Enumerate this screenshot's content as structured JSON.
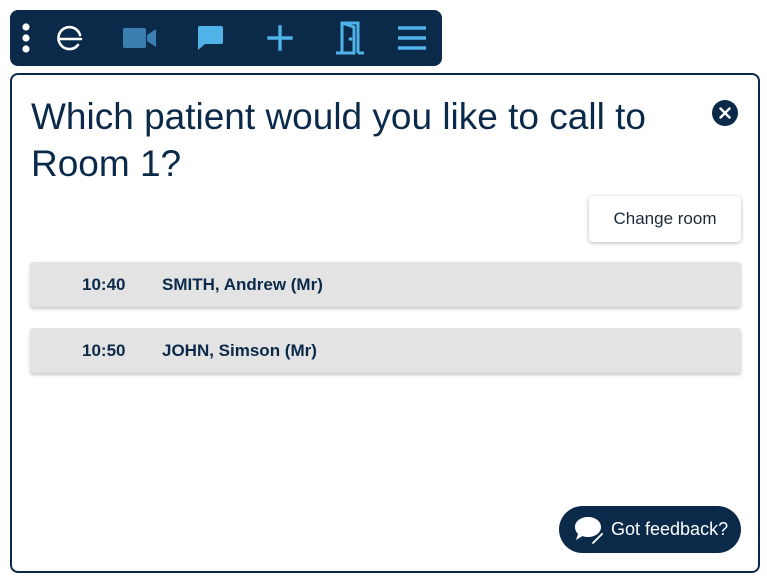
{
  "toolbar": {
    "items": [
      {
        "icon": "more-vertical-icon"
      },
      {
        "icon": "e-logo-icon"
      },
      {
        "icon": "video-camera-icon"
      },
      {
        "icon": "chat-icon"
      },
      {
        "icon": "plus-icon"
      },
      {
        "icon": "door-icon"
      },
      {
        "icon": "menu-icon"
      }
    ],
    "colors": {
      "background": "#0b2a4a",
      "icon": "#4fb3e8"
    }
  },
  "dialog": {
    "title": "Which patient would you like to call to Room 1?",
    "close_icon": "close-circle-icon",
    "change_room_label": "Change room",
    "patients": [
      {
        "time": "10:40",
        "name": "SMITH, Andrew (Mr)"
      },
      {
        "time": "10:50",
        "name": "JOHN, Simson (Mr)"
      }
    ]
  },
  "feedback": {
    "label": "Got feedback?",
    "icon": "feedback-chat-icon"
  }
}
